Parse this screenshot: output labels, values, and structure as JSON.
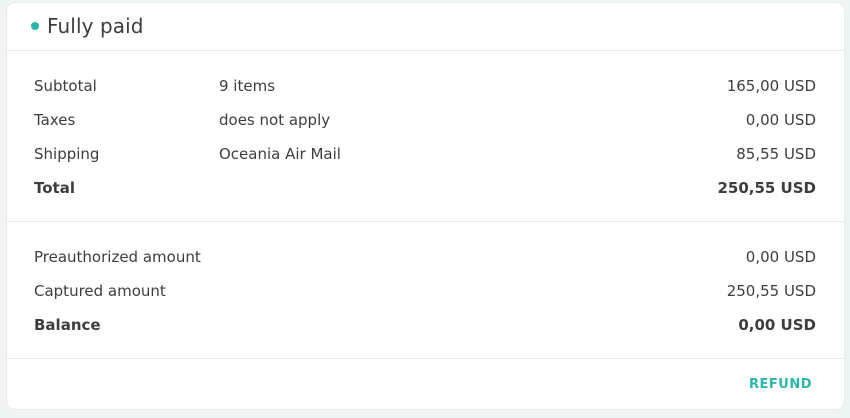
{
  "header": {
    "status": "Fully paid",
    "status_color": "#2ab7a9"
  },
  "totals": {
    "subtotal": {
      "label": "Subtotal",
      "desc": "9 items",
      "value": "165,00 USD"
    },
    "taxes": {
      "label": "Taxes",
      "desc": "does not apply",
      "value": "0,00 USD"
    },
    "shipping": {
      "label": "Shipping",
      "desc": "Oceania Air Mail",
      "value": "85,55 USD"
    },
    "total": {
      "label": "Total",
      "value": "250,55 USD"
    }
  },
  "payments": {
    "preauthorized": {
      "label": "Preauthorized amount",
      "value": "0,00 USD"
    },
    "captured": {
      "label": "Captured amount",
      "value": "250,55 USD"
    },
    "balance": {
      "label": "Balance",
      "value": "0,00 USD"
    }
  },
  "footer": {
    "refund_label": "REFUND"
  }
}
